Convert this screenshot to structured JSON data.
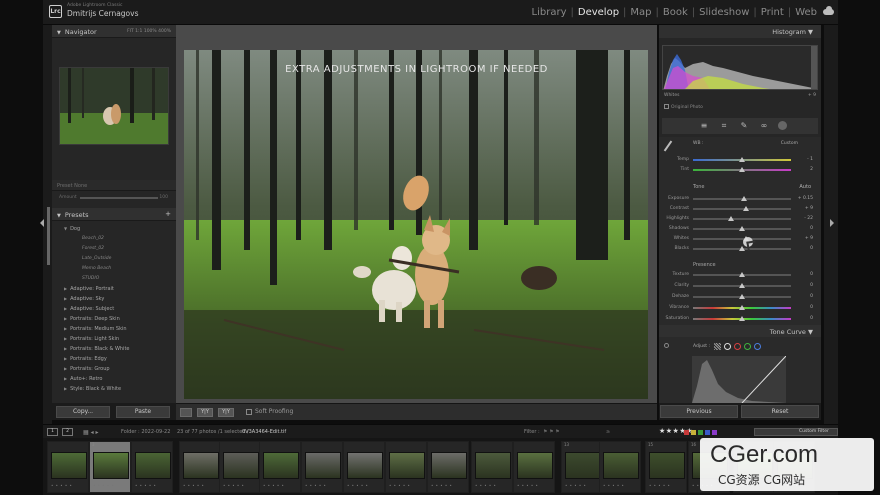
{
  "app": {
    "name": "Adobe Lightroom Classic",
    "user": "Dmitrijs Cernagovs",
    "logo": "Lrc"
  },
  "modules": [
    {
      "label": "Library",
      "active": false
    },
    {
      "label": "Develop",
      "active": true
    },
    {
      "label": "Map",
      "active": false
    },
    {
      "label": "Book",
      "active": false
    },
    {
      "label": "Slideshow",
      "active": false
    },
    {
      "label": "Print",
      "active": false
    },
    {
      "label": "Web",
      "active": false
    }
  ],
  "left": {
    "navigator": {
      "title": "Navigator",
      "options": "FIT  1:1  100%  400%"
    },
    "snapshot": {
      "title": "Preset   None",
      "amount": "Amount",
      "amount_value": "100"
    },
    "presets": {
      "title": "Presets",
      "items": [
        {
          "label": "Dog",
          "type": "group"
        },
        {
          "label": "Beach_02",
          "type": "child"
        },
        {
          "label": "Forest_02",
          "type": "child"
        },
        {
          "label": "Late_Outside",
          "type": "child"
        },
        {
          "label": "Memo Beach",
          "type": "child"
        },
        {
          "label": "STUDIO",
          "type": "child"
        },
        {
          "label": "Adaptive: Portrait",
          "type": "group"
        },
        {
          "label": "Adaptive: Sky",
          "type": "group"
        },
        {
          "label": "Adaptive: Subject",
          "type": "group"
        },
        {
          "label": "Portraits: Deep Skin",
          "type": "group"
        },
        {
          "label": "Portraits: Medium Skin",
          "type": "group"
        },
        {
          "label": "Portraits: Light Skin",
          "type": "group"
        },
        {
          "label": "Portraits: Black & White",
          "type": "group"
        },
        {
          "label": "Portraits: Edgy",
          "type": "group"
        },
        {
          "label": "Portraits: Group",
          "type": "group"
        },
        {
          "label": "Auto+: Retro",
          "type": "group"
        },
        {
          "label": "Style: Black & White",
          "type": "group"
        }
      ]
    },
    "copy_label": "Copy...",
    "paste_label": "Paste"
  },
  "center": {
    "overlay_text": "EXTRA ADJUSTMENTS IN LIGHTROOM IF NEEDED",
    "toolbar": {
      "view_label": "",
      "softproof_label": "Soft Proofing"
    }
  },
  "right": {
    "histogram": {
      "title": "Histogram",
      "label": "Whites",
      "value": "+ 9",
      "original_photo": "Original Photo"
    },
    "basic": {
      "wb_label": "WB :",
      "wb_value": "Custom",
      "tone_label": "Tone",
      "auto_label": "Auto",
      "presence_label": "Presence",
      "sliders_wb": [
        {
          "label": "Temp",
          "value": "- 1",
          "pos": 0.5
        },
        {
          "label": "Tint",
          "value": "2",
          "pos": 0.5
        }
      ],
      "sliders_tone": [
        {
          "label": "Exposure",
          "value": "+ 0.15",
          "pos": 0.52
        },
        {
          "label": "Contrast",
          "value": "+ 9",
          "pos": 0.54
        },
        {
          "label": "Highlights",
          "value": "- 22",
          "pos": 0.39
        },
        {
          "label": "Shadows",
          "value": "0",
          "pos": 0.5
        },
        {
          "label": "Whites",
          "value": "+ 9",
          "pos": 0.54
        },
        {
          "label": "Blacks",
          "value": "0",
          "pos": 0.5
        }
      ],
      "sliders_presence": [
        {
          "label": "Texture",
          "value": "0",
          "pos": 0.5
        },
        {
          "label": "Clarity",
          "value": "0",
          "pos": 0.5
        },
        {
          "label": "Dehaze",
          "value": "0",
          "pos": 0.5
        },
        {
          "label": "Vibrance",
          "value": "0",
          "pos": 0.5
        },
        {
          "label": "Saturation",
          "value": "0",
          "pos": 0.5
        }
      ]
    },
    "tone_curve": {
      "title": "Tone Curve",
      "adjust_label": "Adjust :"
    },
    "previous_label": "Previous",
    "reset_label": "Reset"
  },
  "filmstrip": {
    "page1": "1",
    "page2": "2",
    "folder": "Folder : 2022-09-22",
    "count": "23 of 77 photos /1 selected /",
    "filename": "0V3A3464-Edit.tif",
    "filter_label": "Filter :",
    "stars": "★★★★★",
    "custom_filter": "Custom Filter",
    "thumb_numbers": [
      "",
      "3",
      "",
      "",
      "",
      "",
      "",
      "",
      "",
      "",
      "",
      "",
      "13",
      "",
      "15",
      "16",
      "",
      ""
    ]
  },
  "watermark": {
    "big": "CGer.com",
    "small": "CG资源 CG网站"
  }
}
